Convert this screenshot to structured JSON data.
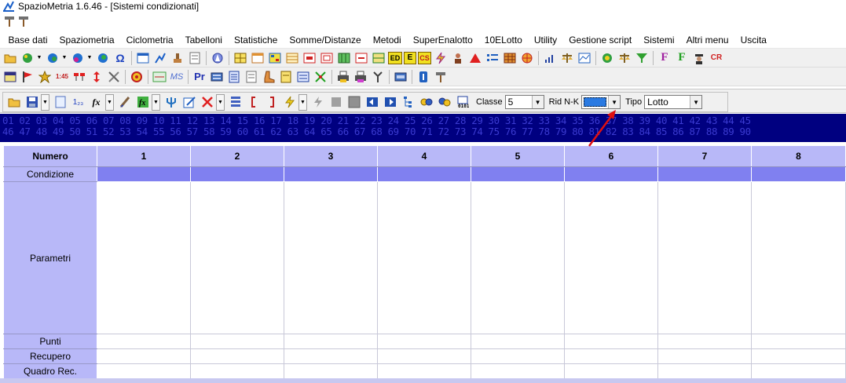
{
  "window": {
    "title": "SpazioMetria  1.6.46 - [Sistemi condizionati]"
  },
  "menu": [
    "Base dati",
    "Spaziometria",
    "Ciclometria",
    "Tabelloni",
    "Statistiche",
    "Somme/Distanze",
    "Metodi",
    "SuperEnalotto",
    "10ELotto",
    "Utility",
    "Gestione script",
    "Sistemi",
    "Altri menu",
    "Uscita"
  ],
  "toolbar1": {
    "lbl_omega": "Ω",
    "lbl_ed": "ED",
    "lbl_e": "E",
    "lbl_cs": "CS",
    "lbl_f1": "F",
    "lbl_f2": "F",
    "lbl_cr": "CR"
  },
  "toolbar2": {
    "lbl_145": "1:45",
    "lbl_ms": "MS",
    "lbl_pr": "Pr"
  },
  "editor_toolbar": {
    "lbl_123": "1₂₃",
    "lbl_fx": "fx",
    "classe_label": "Classe",
    "classe_value": "5",
    "rid_label": "Rid N-K",
    "rid_value": "",
    "tipo_label": "Tipo",
    "tipo_value": "Lotto"
  },
  "number_strip": {
    "row1": "01 02 03 04 05 06 07 08 09 10 11 12 13 14 15 16 17 18 19 20 21 22 23 24 25 26 27 28 29 30 31 32 33 34 35 36 37 38 39 40 41 42 43 44 45",
    "row2": "46 47 48 49 50 51 52 53 54 55 56 57 58 59 60 61 62 63 64 65 66 67 68 69 70 71 72 73 74 75 76 77 78 79 80 81 82 83 84 85 86 87 88 89 90"
  },
  "grid": {
    "header_label": "Numero",
    "columns": [
      "1",
      "2",
      "3",
      "4",
      "5",
      "6",
      "7",
      "8"
    ],
    "rows": {
      "condizione": "Condizione",
      "parametri": "Parametri",
      "punti": "Punti",
      "recupero": "Recupero",
      "quadro": "Quadro Rec."
    }
  },
  "colors": {
    "grid_header": "#b8b8f8",
    "condition_cells": "#8080f0",
    "number_strip_bg": "#000080",
    "rid_combo_fill": "#2a7ae2",
    "annotation_arrow": "#e01010"
  }
}
